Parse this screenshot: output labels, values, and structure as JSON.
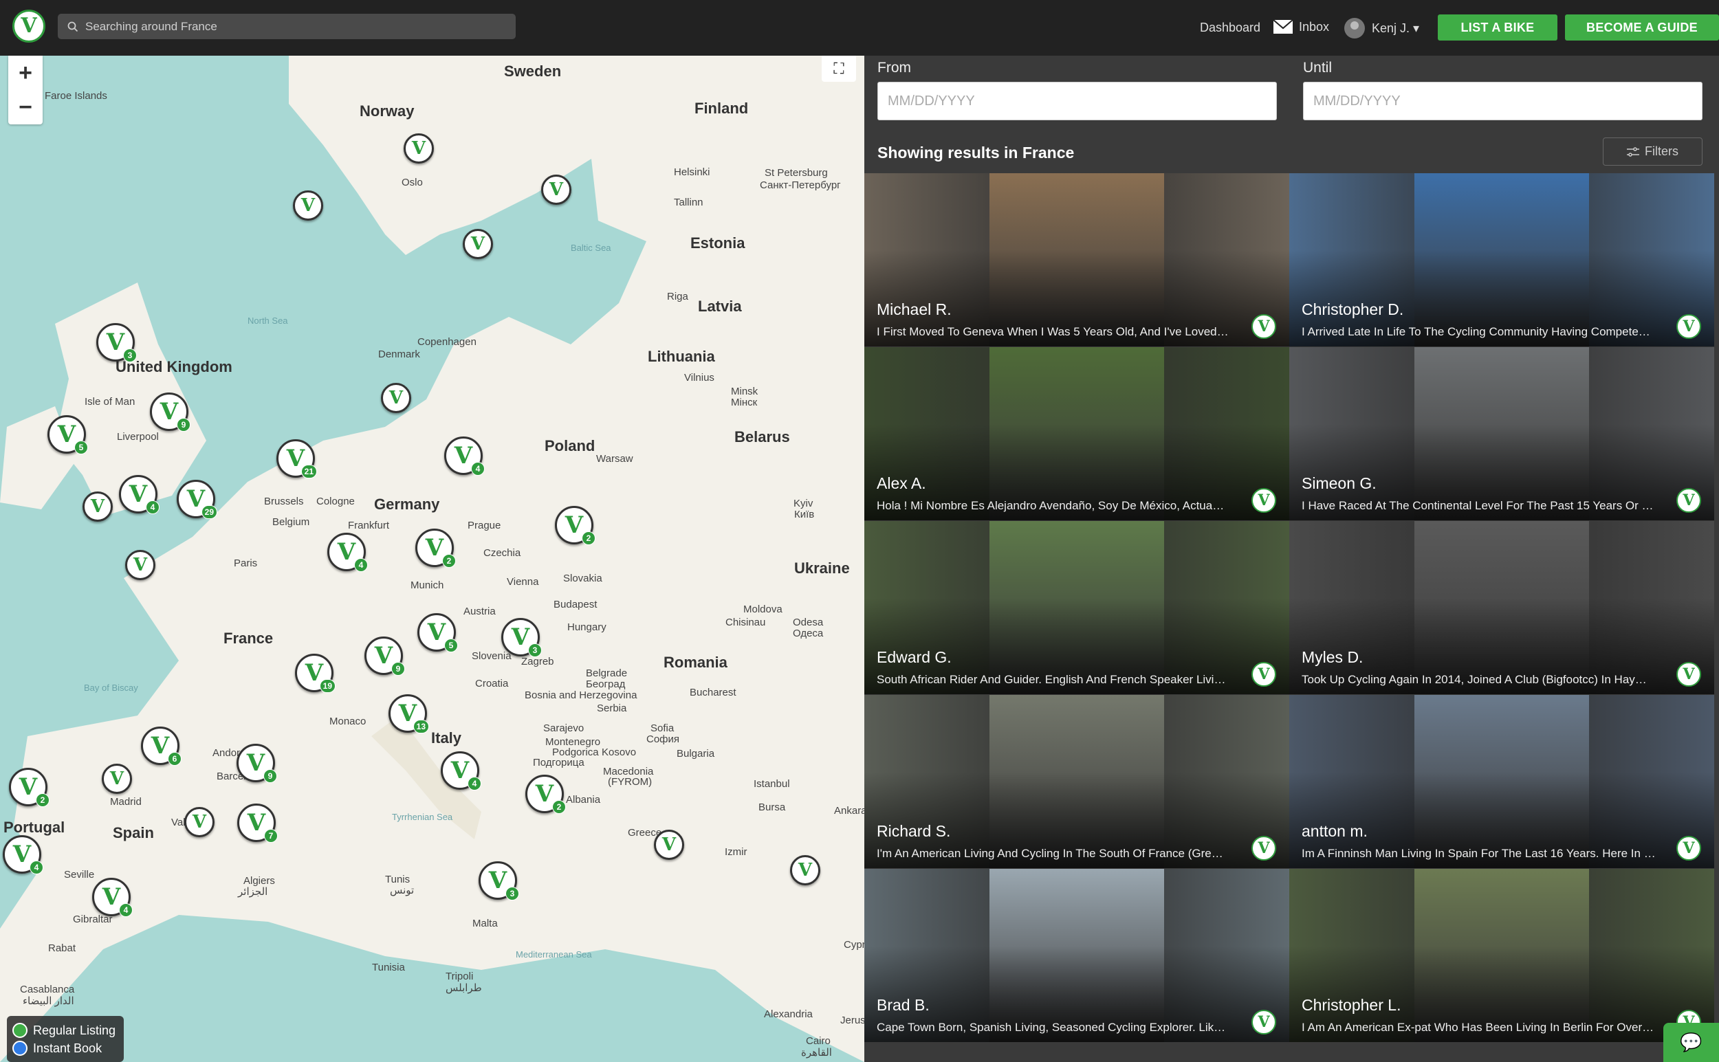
{
  "header": {
    "search_placeholder": "Searching around France",
    "dashboard": "Dashboard",
    "inbox": "Inbox",
    "user": "Kenj J. ▾",
    "list_bike": "LIST A BIKE",
    "become_guide": "BECOME A GUIDE"
  },
  "logo": {
    "letter": "V"
  },
  "map": {
    "labels": [
      {
        "text": "Sweden",
        "cls": "",
        "pos": [
          733,
          10
        ]
      },
      {
        "text": "Norway",
        "cls": "",
        "pos": [
          523,
          68
        ]
      },
      {
        "text": "Finland",
        "cls": "",
        "pos": [
          1010,
          64
        ]
      },
      {
        "text": "Faroe Islands",
        "cls": "sm",
        "pos": [
          65,
          50
        ]
      },
      {
        "text": "Oslo",
        "cls": "sm",
        "pos": [
          584,
          176
        ]
      },
      {
        "text": "Helsinki",
        "cls": "sm",
        "pos": [
          980,
          161
        ]
      },
      {
        "text": "St Petersburg",
        "cls": "sm",
        "pos": [
          1112,
          162
        ]
      },
      {
        "text": "Санкт-Петербург",
        "cls": "sm",
        "pos": [
          1105,
          180
        ]
      },
      {
        "text": "Tallinn",
        "cls": "sm",
        "pos": [
          980,
          205
        ]
      },
      {
        "text": "Estonia",
        "cls": "",
        "pos": [
          1004,
          260
        ]
      },
      {
        "text": "Riga",
        "cls": "sm",
        "pos": [
          970,
          342
        ]
      },
      {
        "text": "Latvia",
        "cls": "",
        "pos": [
          1015,
          352
        ]
      },
      {
        "text": "North Sea",
        "cls": "sea",
        "pos": [
          360,
          378
        ]
      },
      {
        "text": "Baltic Sea",
        "cls": "sea",
        "pos": [
          830,
          272
        ]
      },
      {
        "text": "Copenhagen",
        "cls": "sm",
        "pos": [
          607,
          408
        ]
      },
      {
        "text": "Denmark",
        "cls": "sm",
        "pos": [
          550,
          426
        ]
      },
      {
        "text": "Lithuania",
        "cls": "",
        "pos": [
          942,
          425
        ]
      },
      {
        "text": "Vilnius",
        "cls": "sm",
        "pos": [
          995,
          460
        ]
      },
      {
        "text": "Minsk",
        "cls": "sm",
        "pos": [
          1063,
          480
        ]
      },
      {
        "text": "Мінск",
        "cls": "sm",
        "pos": [
          1063,
          496
        ]
      },
      {
        "text": "Belarus",
        "cls": "",
        "pos": [
          1068,
          542
        ]
      },
      {
        "text": "United Kingdom",
        "cls": "",
        "pos": [
          168,
          440
        ]
      },
      {
        "text": "Isle of Man",
        "cls": "sm",
        "pos": [
          123,
          495
        ]
      },
      {
        "text": "Liverpool",
        "cls": "sm",
        "pos": [
          170,
          546
        ]
      },
      {
        "text": "Poland",
        "cls": "",
        "pos": [
          792,
          555
        ]
      },
      {
        "text": "Warsaw",
        "cls": "sm",
        "pos": [
          867,
          578
        ]
      },
      {
        "text": "Germany",
        "cls": "",
        "pos": [
          544,
          640
        ]
      },
      {
        "text": "Brussels",
        "cls": "sm",
        "pos": [
          384,
          640
        ]
      },
      {
        "text": "Cologne",
        "cls": "sm",
        "pos": [
          460,
          640
        ]
      },
      {
        "text": "Belgium",
        "cls": "sm",
        "pos": [
          396,
          670
        ]
      },
      {
        "text": "Frankfurt",
        "cls": "sm",
        "pos": [
          506,
          675
        ]
      },
      {
        "text": "Prague",
        "cls": "sm",
        "pos": [
          680,
          675
        ]
      },
      {
        "text": "Kyiv",
        "cls": "sm",
        "pos": [
          1154,
          643
        ]
      },
      {
        "text": "Київ",
        "cls": "sm",
        "pos": [
          1155,
          659
        ]
      },
      {
        "text": "Czechia",
        "cls": "sm",
        "pos": [
          703,
          715
        ]
      },
      {
        "text": "Paris",
        "cls": "sm",
        "pos": [
          340,
          730
        ]
      },
      {
        "text": "Ukraine",
        "cls": "",
        "pos": [
          1155,
          733
        ]
      },
      {
        "text": "Slovakia",
        "cls": "sm",
        "pos": [
          819,
          752
        ]
      },
      {
        "text": "Vienna",
        "cls": "sm",
        "pos": [
          737,
          757
        ]
      },
      {
        "text": "Munich",
        "cls": "sm",
        "pos": [
          597,
          762
        ]
      },
      {
        "text": "Budapest",
        "cls": "sm",
        "pos": [
          805,
          790
        ]
      },
      {
        "text": "Moldova",
        "cls": "sm",
        "pos": [
          1081,
          797
        ]
      },
      {
        "text": "Austria",
        "cls": "sm",
        "pos": [
          674,
          800
        ]
      },
      {
        "text": "Odesa",
        "cls": "sm",
        "pos": [
          1153,
          816
        ]
      },
      {
        "text": "Одеса",
        "cls": "sm",
        "pos": [
          1153,
          832
        ]
      },
      {
        "text": "Chisinau",
        "cls": "sm",
        "pos": [
          1055,
          816
        ]
      },
      {
        "text": "Hungary",
        "cls": "sm",
        "pos": [
          825,
          823
        ]
      },
      {
        "text": "France",
        "cls": "",
        "pos": [
          325,
          835
        ]
      },
      {
        "text": "Slovenia",
        "cls": "sm",
        "pos": [
          686,
          865
        ]
      },
      {
        "text": "Zagreb",
        "cls": "sm",
        "pos": [
          758,
          873
        ]
      },
      {
        "text": "Romania",
        "cls": "",
        "pos": [
          965,
          870
        ]
      },
      {
        "text": "Bay of Biscay",
        "cls": "sea",
        "pos": [
          122,
          912
        ]
      },
      {
        "text": "Croatia",
        "cls": "sm",
        "pos": [
          691,
          905
        ]
      },
      {
        "text": "Belgrade",
        "cls": "sm",
        "pos": [
          852,
          890
        ]
      },
      {
        "text": "Београд",
        "cls": "sm",
        "pos": [
          852,
          906
        ]
      },
      {
        "text": "Bucharest",
        "cls": "sm",
        "pos": [
          1003,
          918
        ]
      },
      {
        "text": "Bosnia and Herzegovina",
        "cls": "sm",
        "pos": [
          763,
          922
        ]
      },
      {
        "text": "Serbia",
        "cls": "sm",
        "pos": [
          868,
          941
        ]
      },
      {
        "text": "Monaco",
        "cls": "sm",
        "pos": [
          479,
          960
        ]
      },
      {
        "text": "Sarajevo",
        "cls": "sm",
        "pos": [
          790,
          970
        ]
      },
      {
        "text": "Sofia",
        "cls": "sm",
        "pos": [
          946,
          970
        ]
      },
      {
        "text": "София",
        "cls": "sm",
        "pos": [
          940,
          986
        ]
      },
      {
        "text": "Italy",
        "cls": "",
        "pos": [
          627,
          980
        ]
      },
      {
        "text": "Andorra",
        "cls": "sm",
        "pos": [
          309,
          1006
        ]
      },
      {
        "text": "Montenegro",
        "cls": "sm",
        "pos": [
          793,
          990
        ]
      },
      {
        "text": "Podgorica",
        "cls": "sm",
        "pos": [
          803,
          1005
        ]
      },
      {
        "text": "Kosovo",
        "cls": "sm",
        "pos": [
          875,
          1005
        ]
      },
      {
        "text": "Bulgaria",
        "cls": "sm",
        "pos": [
          984,
          1007
        ]
      },
      {
        "text": "Подгорица",
        "cls": "sm",
        "pos": [
          775,
          1020
        ]
      },
      {
        "text": "Macedonia",
        "cls": "sm",
        "pos": [
          877,
          1033
        ]
      },
      {
        "text": "(FYROM)",
        "cls": "sm",
        "pos": [
          884,
          1048
        ]
      },
      {
        "text": "Istanbul",
        "cls": "sm",
        "pos": [
          1096,
          1051
        ]
      },
      {
        "text": "Barcelona",
        "cls": "sm",
        "pos": [
          315,
          1040
        ]
      },
      {
        "text": "Madrid",
        "cls": "sm",
        "pos": [
          160,
          1077
        ]
      },
      {
        "text": "Albania",
        "cls": "sm",
        "pos": [
          823,
          1074
        ]
      },
      {
        "text": "Bursa",
        "cls": "sm",
        "pos": [
          1103,
          1085
        ]
      },
      {
        "text": "Ankara",
        "cls": "sm",
        "pos": [
          1213,
          1090
        ]
      },
      {
        "text": "Tyrrhenian Sea",
        "cls": "sea",
        "pos": [
          570,
          1100
        ]
      },
      {
        "text": "Portugal",
        "cls": "",
        "pos": [
          5,
          1110
        ]
      },
      {
        "text": "Valencia",
        "cls": "sm",
        "pos": [
          249,
          1107
        ]
      },
      {
        "text": "Spain",
        "cls": "",
        "pos": [
          164,
          1118
        ]
      },
      {
        "text": "Greece",
        "cls": "sm",
        "pos": [
          913,
          1122
        ]
      },
      {
        "text": "Izmir",
        "cls": "sm",
        "pos": [
          1054,
          1150
        ]
      },
      {
        "text": "Seville",
        "cls": "sm",
        "pos": [
          93,
          1183
        ]
      },
      {
        "text": "Algiers",
        "cls": "sm",
        "pos": [
          354,
          1192
        ]
      },
      {
        "text": "Tunis",
        "cls": "sm",
        "pos": [
          560,
          1190
        ]
      },
      {
        "text": "الجزائر",
        "cls": "sm",
        "pos": [
          346,
          1207
        ]
      },
      {
        "text": "تونس",
        "cls": "sm",
        "pos": [
          567,
          1205
        ]
      },
      {
        "text": "Gibraltar",
        "cls": "sm",
        "pos": [
          106,
          1248
        ]
      },
      {
        "text": "Malta",
        "cls": "sm",
        "pos": [
          687,
          1254
        ]
      },
      {
        "text": "Rabat",
        "cls": "sm",
        "pos": [
          70,
          1290
        ]
      },
      {
        "text": "Mediterranean Sea",
        "cls": "sea",
        "pos": [
          750,
          1300
        ]
      },
      {
        "text": "Cyprus",
        "cls": "sm",
        "pos": [
          1227,
          1285
        ]
      },
      {
        "text": "Tunisia",
        "cls": "sm",
        "pos": [
          541,
          1318
        ]
      },
      {
        "text": "Casablanca",
        "cls": "sm",
        "pos": [
          29,
          1350
        ]
      },
      {
        "text": "Tripoli",
        "cls": "sm",
        "pos": [
          648,
          1331
        ]
      },
      {
        "text": "طرابلس",
        "cls": "sm",
        "pos": [
          648,
          1347
        ]
      },
      {
        "text": "الدار البيضاء",
        "cls": "sm",
        "pos": [
          33,
          1366
        ]
      },
      {
        "text": "Alexandria",
        "cls": "sm",
        "pos": [
          1111,
          1386
        ]
      },
      {
        "text": "Jerusalem",
        "cls": "sm",
        "pos": [
          1222,
          1395
        ]
      },
      {
        "text": "Cairo",
        "cls": "sm",
        "pos": [
          1172,
          1425
        ]
      },
      {
        "text": "القاهرة",
        "cls": "sm",
        "pos": [
          1165,
          1441
        ]
      }
    ],
    "markers": [
      {
        "pos": [
          587,
          113
        ],
        "size": "sm",
        "count": ""
      },
      {
        "pos": [
          426,
          196
        ],
        "size": "sm",
        "count": ""
      },
      {
        "pos": [
          787,
          173
        ],
        "size": "sm",
        "count": ""
      },
      {
        "pos": [
          673,
          252
        ],
        "size": "sm",
        "count": ""
      },
      {
        "pos": [
          140,
          389
        ],
        "size": "",
        "count": "3"
      },
      {
        "pos": [
          554,
          476
        ],
        "size": "sm",
        "count": ""
      },
      {
        "pos": [
          218,
          490
        ],
        "size": "",
        "count": "9"
      },
      {
        "pos": [
          69,
          523
        ],
        "size": "",
        "count": "5"
      },
      {
        "pos": [
          402,
          558
        ],
        "size": "",
        "count": "21"
      },
      {
        "pos": [
          646,
          554
        ],
        "size": "",
        "count": "4"
      },
      {
        "pos": [
          173,
          610
        ],
        "size": "",
        "count": "4"
      },
      {
        "pos": [
          257,
          617
        ],
        "size": "",
        "count": "29"
      },
      {
        "pos": [
          120,
          634
        ],
        "size": "sm",
        "count": ""
      },
      {
        "pos": [
          807,
          655
        ],
        "size": "",
        "count": "2"
      },
      {
        "pos": [
          476,
          694
        ],
        "size": "",
        "count": "4"
      },
      {
        "pos": [
          604,
          688
        ],
        "size": "",
        "count": "2"
      },
      {
        "pos": [
          182,
          719
        ],
        "size": "sm",
        "count": ""
      },
      {
        "pos": [
          607,
          811
        ],
        "size": "",
        "count": "5"
      },
      {
        "pos": [
          729,
          818
        ],
        "size": "",
        "count": "3"
      },
      {
        "pos": [
          530,
          845
        ],
        "size": "",
        "count": "9"
      },
      {
        "pos": [
          429,
          870
        ],
        "size": "",
        "count": "19"
      },
      {
        "pos": [
          565,
          929
        ],
        "size": "",
        "count": "13"
      },
      {
        "pos": [
          205,
          976
        ],
        "size": "",
        "count": "6"
      },
      {
        "pos": [
          344,
          1001
        ],
        "size": "",
        "count": "9"
      },
      {
        "pos": [
          148,
          1030
        ],
        "size": "sm",
        "count": ""
      },
      {
        "pos": [
          13,
          1036
        ],
        "size": "",
        "count": "2"
      },
      {
        "pos": [
          641,
          1012
        ],
        "size": "",
        "count": "4"
      },
      {
        "pos": [
          764,
          1046
        ],
        "size": "",
        "count": "2"
      },
      {
        "pos": [
          268,
          1093
        ],
        "size": "sm",
        "count": ""
      },
      {
        "pos": [
          345,
          1088
        ],
        "size": "",
        "count": "7"
      },
      {
        "pos": [
          951,
          1126
        ],
        "size": "sm",
        "count": ""
      },
      {
        "pos": [
          4,
          1134
        ],
        "size": "",
        "count": "4"
      },
      {
        "pos": [
          1149,
          1163
        ],
        "size": "sm",
        "count": ""
      },
      {
        "pos": [
          696,
          1172
        ],
        "size": "",
        "count": "3"
      },
      {
        "pos": [
          134,
          1196
        ],
        "size": "",
        "count": "4"
      }
    ],
    "legend": {
      "regular": "Regular Listing",
      "instant": "Instant Book",
      "regular_color": "#3fad46",
      "instant_color": "#2f7be5"
    }
  },
  "dates": {
    "from_label": "From",
    "until_label": "Until",
    "placeholder": "MM/DD/YYYY"
  },
  "results": {
    "title": "Showing results in France",
    "filters": "Filters",
    "guides": [
      {
        "name": "Michael R.",
        "desc": "I First Moved To Geneva When I Was 5 Years Old, And I've Loved…",
        "bg": "#6c6358",
        "photo": "#8a6f52"
      },
      {
        "name": "Christopher D.",
        "desc": "I Arrived Late In Life To The Cycling Community Having Compete…",
        "bg": "#4d6c8f",
        "photo": "#3d6fa8"
      },
      {
        "name": "Alex A.",
        "desc": "Hola ! Mi Nombre Es Alejandro Avendaño, Soy De México,  Actua…",
        "bg": "#3b4a2f",
        "photo": "#4f6b38"
      },
      {
        "name": "Simeon G.",
        "desc": "I Have Raced At The Continental Level For The Past 15 Years Or …",
        "bg": "#55575a",
        "photo": "#6d7072"
      },
      {
        "name": "Edward G.",
        "desc": "South African Rider And Guider. English And French Speaker Livi…",
        "bg": "#4a5a3c",
        "photo": "#5e7a4a"
      },
      {
        "name": "Myles D.",
        "desc": "Took Up Cycling Again In 2014, Joined A Club (Bigfootcc) In Hay…",
        "bg": "#4a4a4a",
        "photo": "#5a5a5a"
      },
      {
        "name": "Richard S.",
        "desc": "I'm An American Living And Cycling In The South Of France (Gre…",
        "bg": "#5a5e56",
        "photo": "#74786c"
      },
      {
        "name": "antton m.",
        "desc": "Im A Finninsh Man Living In Spain For The Last 16 Years. Here In …",
        "bg": "#4c5868",
        "photo": "#6a7a8c"
      },
      {
        "name": "Brad B.",
        "desc": "Cape Town Born, Spanish Living, Seasoned Cycling Explorer. Lik…",
        "bg": "#5f6a70",
        "photo": "#9aa7b0"
      },
      {
        "name": "Christopher L.",
        "desc": "I Am An American Ex-pat Who Has Been Living In Berlin For Over…",
        "bg": "#4c5a3e",
        "photo": "#6c7a52"
      }
    ]
  }
}
